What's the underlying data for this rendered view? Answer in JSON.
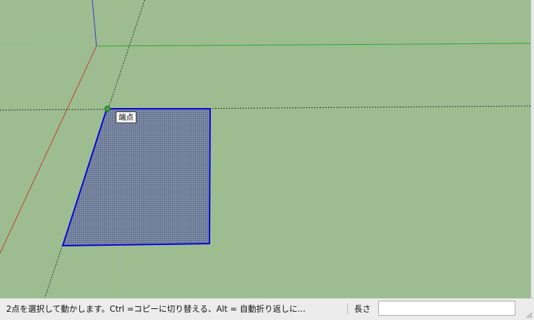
{
  "viewport": {
    "tooltip": "端点",
    "colors": {
      "background": "#9dbd91",
      "face_fill": "#7d8aa6",
      "face_edge": "#0000e0",
      "red_axis": "#c03a2a",
      "green_axis": "#2aa72a",
      "blue_axis": "#3030d0",
      "inference_point": "#2f9e2f"
    }
  },
  "statusbar": {
    "message": "2点を選択して動かします。Ctrl =コピーに切り替える、Alt = 自動折り返しに...",
    "measure_label": "長さ",
    "measure_value": ""
  }
}
